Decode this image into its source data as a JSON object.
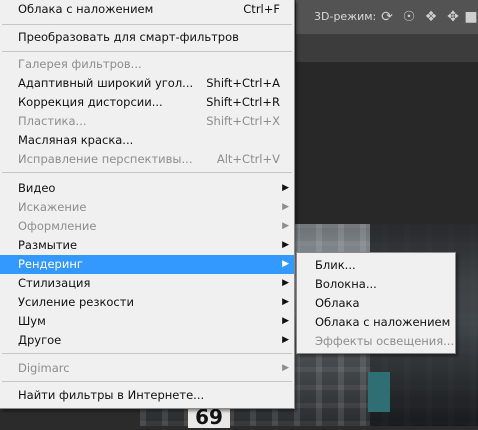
{
  "topbar": {
    "mode_label": "3D-режим:"
  },
  "menu": {
    "recent": {
      "label": "Облака с наложением",
      "shortcut": "Ctrl+F"
    },
    "smart": {
      "label": "Преобразовать для смарт-фильтров"
    },
    "gallery": {
      "label": "Галерея фильтров..."
    },
    "adaptive": {
      "label": "Адаптивный широкий угол...",
      "shortcut": "Shift+Ctrl+A"
    },
    "lens": {
      "label": "Коррекция дисторсии...",
      "shortcut": "Shift+Ctrl+R"
    },
    "liquify": {
      "label": "Пластика...",
      "shortcut": "Shift+Ctrl+X"
    },
    "oil": {
      "label": "Масляная краска..."
    },
    "vanish": {
      "label": "Исправление перспективы...",
      "shortcut": "Alt+Ctrl+V"
    },
    "video": {
      "label": "Видео"
    },
    "distort": {
      "label": "Искажение"
    },
    "stylize_art": {
      "label": "Оформление"
    },
    "blur": {
      "label": "Размытие"
    },
    "render": {
      "label": "Рендеринг"
    },
    "stylize": {
      "label": "Стилизация"
    },
    "sharpen": {
      "label": "Усиление резкости"
    },
    "noise": {
      "label": "Шум"
    },
    "other": {
      "label": "Другое"
    },
    "digimarc": {
      "label": "Digimarc"
    },
    "browse": {
      "label": "Найти фильтры в Интернете..."
    }
  },
  "submenu": {
    "flare": {
      "label": "Блик..."
    },
    "fibers": {
      "label": "Волокна..."
    },
    "clouds": {
      "label": "Облака"
    },
    "diff_clouds": {
      "label": "Облака с наложением"
    },
    "lighting": {
      "label": "Эффекты освещения..."
    }
  },
  "background": {
    "plate_number": "69"
  }
}
